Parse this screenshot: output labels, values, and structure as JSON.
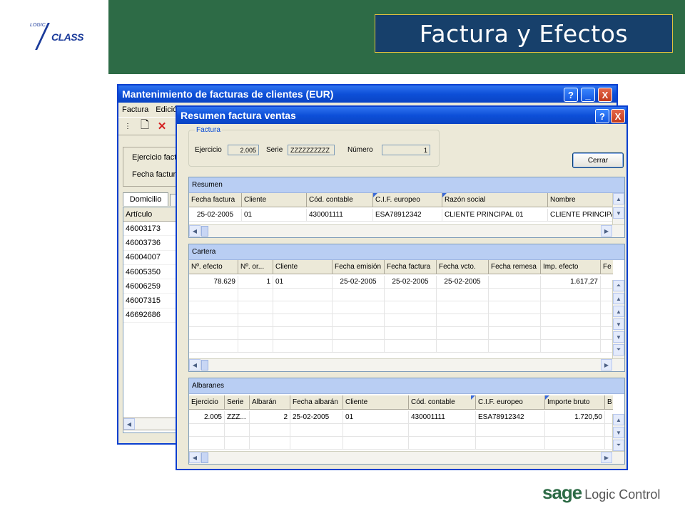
{
  "slide": {
    "title": "Factura y Efectos",
    "logo_top": "LOGIC",
    "logo_main": "CLASS",
    "brand": "sage",
    "brand_suffix": "Logic Control",
    "colors": {
      "header_green": "#2d6b46",
      "title_box": "#17406b",
      "title_border": "#e0c040",
      "xp_blue": "#0a3fcf"
    }
  },
  "back_window": {
    "title": "Mantenimiento de facturas de clientes (EUR)",
    "menu": [
      "Factura",
      "Edició"
    ],
    "form_labels": [
      "Ejercicio fact",
      "Fecha factur"
    ],
    "tab": "Domicilio",
    "list_header": "Artículo",
    "articles": [
      "46003173",
      "46003736",
      "46004007",
      "46005350",
      "46006259",
      "46007315",
      "46692686"
    ],
    "buttons": {
      "help": "?",
      "minimize": "_",
      "close": "X"
    }
  },
  "front_window": {
    "title": "Resumen factura ventas",
    "buttons": {
      "help": "?",
      "close": "X"
    },
    "factura_group": {
      "legend": "Factura",
      "ejercicio_label": "Ejercicio",
      "ejercicio_value": "2.005",
      "serie_label": "Serie",
      "serie_value": "ZZZZZZZZZZ",
      "numero_label": "Número",
      "numero_value": "1"
    },
    "cerrar_label": "Cerrar",
    "resumen": {
      "title": "Resumen",
      "columns": [
        "Fecha factura",
        "Cliente",
        "Cód. contable",
        "C.I.F. europeo",
        "Razón social",
        "Nombre"
      ],
      "rows": [
        [
          "25-02-2005",
          "01",
          "430001111",
          "ESA78912342",
          "CLIENTE PRINCIPAL 01",
          "CLIENTE PRINCIPA"
        ]
      ]
    },
    "cartera": {
      "title": "Cartera",
      "columns": [
        "Nº. efecto",
        "Nº. or...",
        "Cliente",
        "Fecha emisión",
        "Fecha factura",
        "Fecha vcto.",
        "Fecha remesa",
        "Imp. efecto",
        "Fe"
      ],
      "rows": [
        [
          "78.629",
          "1",
          "01",
          "25-02-2005",
          "25-02-2005",
          "25-02-2005",
          "",
          "1.617,27",
          ""
        ]
      ]
    },
    "albaranes": {
      "title": "Albaranes",
      "columns": [
        "Ejercicio",
        "Serie",
        "Albarán",
        "Fecha albarán",
        "Cliente",
        "Cód. contable",
        "C.I.F. europeo",
        "Importe bruto",
        "B"
      ],
      "rows": [
        [
          "2.005",
          "ZZZ...",
          "2",
          "25-02-2005",
          "01",
          "430001111",
          "ESA78912342",
          "1.720,50",
          ""
        ]
      ]
    },
    "scroll_glyphs": {
      "up": "▲",
      "down": "▼",
      "left": "◀",
      "right": "▶",
      "top": "⏶",
      "bottom": "⏷"
    }
  }
}
